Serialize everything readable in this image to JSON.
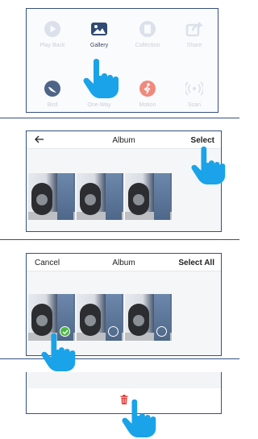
{
  "panel1": {
    "items": [
      {
        "label": "Play Back",
        "icon": "play-icon",
        "active": false
      },
      {
        "label": "Gallery",
        "icon": "gallery-icon",
        "active": true
      },
      {
        "label": "Collection",
        "icon": "collection-icon",
        "active": false
      },
      {
        "label": "Share",
        "icon": "share-icon",
        "active": false
      },
      {
        "label": "Bird",
        "icon": "bird-icon",
        "active": false
      },
      {
        "label": "One-Way",
        "icon": "one-way-icon",
        "active": false
      },
      {
        "label": "Motion",
        "icon": "motion-icon",
        "active": false
      },
      {
        "label": "Scan",
        "icon": "scan-icon",
        "active": false
      }
    ]
  },
  "panel2": {
    "back_icon": "back-arrow-icon",
    "title": "Album",
    "select_label": "Select"
  },
  "panel3": {
    "cancel_label": "Cancel",
    "title": "Album",
    "select_all_label": "Select All"
  },
  "panel4": {
    "delete_icon": "trash-icon"
  },
  "colors": {
    "accent": "#1aa3e8",
    "frame": "#35507f",
    "check": "#4cb843",
    "delete": "#e53935"
  }
}
